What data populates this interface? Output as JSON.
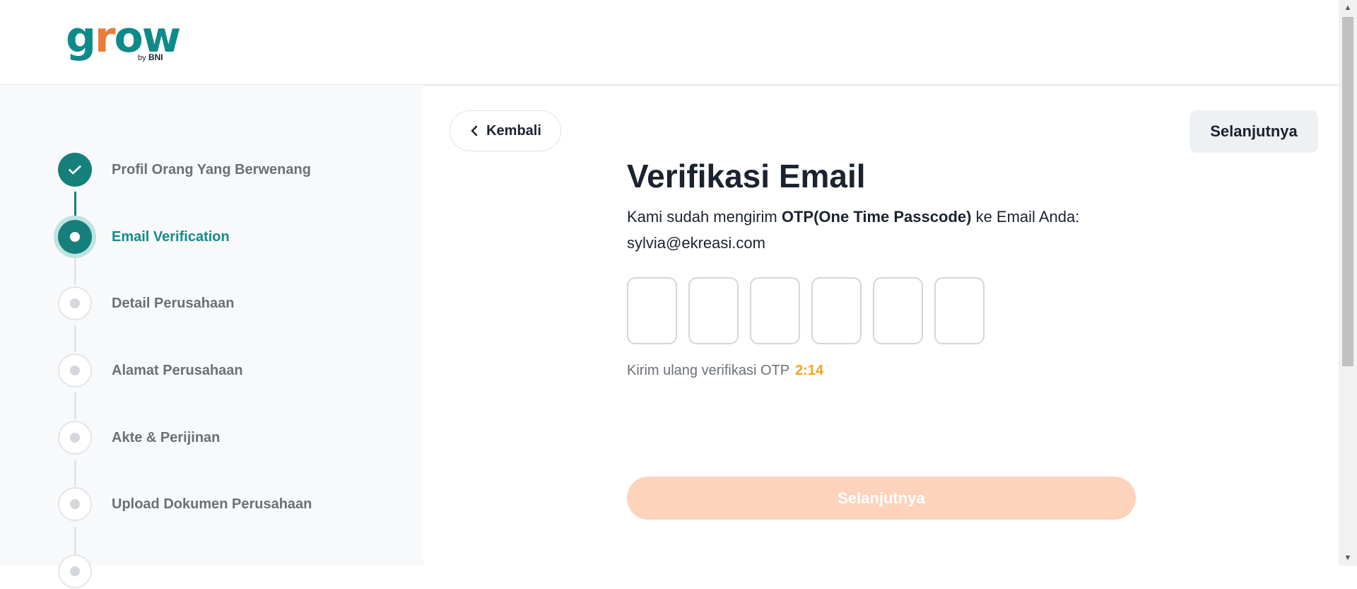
{
  "brand": {
    "name_g": "g",
    "name_r": "r",
    "name_ow": "ow",
    "sub_by": "by",
    "sub_bank": "BNI"
  },
  "colors": {
    "primary": "#157f7b",
    "accent": "#e87e3a",
    "timer": "#f4a51c",
    "disabled_button": "#fdd3bb"
  },
  "sidebar": {
    "steps": [
      {
        "label": "Profil Orang Yang Berwenang",
        "status": "done"
      },
      {
        "label": "Email Verification",
        "status": "active"
      },
      {
        "label": "Detail Perusahaan",
        "status": "pending"
      },
      {
        "label": "Alamat Perusahaan",
        "status": "pending"
      },
      {
        "label": "Akte & Perijinan",
        "status": "pending"
      },
      {
        "label": "Upload Dokumen Perusahaan",
        "status": "pending"
      }
    ]
  },
  "nav": {
    "back_label": "Kembali",
    "back_icon": "chevron-left-icon",
    "next_label": "Selanjutnya"
  },
  "main": {
    "title": "Verifikasi Email",
    "desc_prefix": "Kami sudah mengirim ",
    "desc_bold": "OTP(One Time Passcode)",
    "desc_suffix": " ke Email Anda:",
    "email": "sylvia@ekreasi.com",
    "otp_values": [
      "",
      "",
      "",
      "",
      "",
      ""
    ],
    "resend_label": "Kirim ulang verifikasi OTP",
    "timer": "2:14",
    "submit_label": "Selanjutnya"
  }
}
